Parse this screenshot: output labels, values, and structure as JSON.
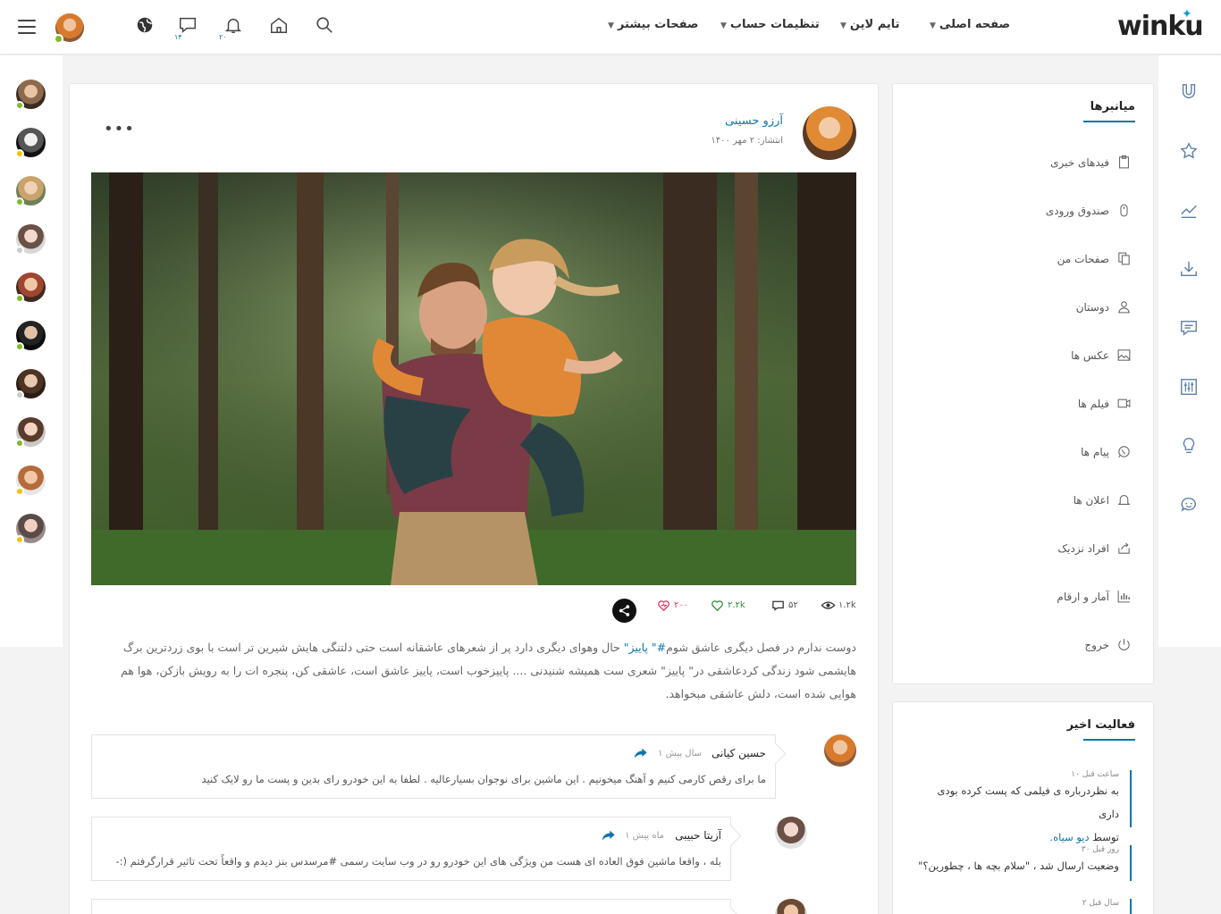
{
  "app": {
    "logo": "winku",
    "accent_color": "#0e75a8",
    "online_color": "#7fbb2a",
    "away_color": "#f4c20d",
    "offline_color": "#cccccc"
  },
  "topbar": {
    "menu": [
      "صفحه اصلی",
      "تایم لاین",
      "تنظیمات حساب",
      "صفحات بیشتر"
    ],
    "messages_badge": "۱۴",
    "notifications_badge": "۲۰"
  },
  "sidebar": {
    "title": "میانبرها",
    "items": [
      "فیدهای خبری",
      "صندوق ورودی",
      "صفحات من",
      "دوستان",
      "عکس ها",
      "فیلم ها",
      "پیام ها",
      "اعلان ها",
      "افراد نزدیک",
      "آمار و ارقام",
      "خروج"
    ]
  },
  "activity": {
    "title": "فعالیت اخیر",
    "items": [
      {
        "time": "۱۰ ساعت قبل",
        "text": "به نظردرباره ی فیلمی که پست کرده بودی داری",
        "by_prefix": "توسط",
        "by": "دیو سیاه."
      },
      {
        "time": "۳۰ روز قبل",
        "text": "وضعیت ارسال شد ، \"سلام بچه ها ، چطورین؟\""
      },
      {
        "time": "۲ سال قبل"
      }
    ]
  },
  "post": {
    "author": "آرزو حسینی",
    "date": "انتشار: ۲ مهر ۱۴۰۰",
    "more": "•••",
    "stats": {
      "views": "۱.۲k",
      "comments": "۵۲",
      "likes": "۲.۲k",
      "loves": "۲۰۰"
    },
    "text_before": "دوست ندارم در فصل دیگری عاشق شوم",
    "hashtag": "#\" پاییز\"",
    "text_after": " حال وهوای دیگری دارد پر از شعرهای عاشقانه است حتی دلتنگی هایش شیرین تر است با بوی زردترین برگ هایشمی شود زندگی کردعاشقی در\" پاییز\" شعری ست همیشه شنیدنی .... پاییزخوب است، پاییز عاشق است، عاشقی کن، پنجره ات را به رویش بازکن، هوا هم هوایی شده است، دلش عاشقی مبخواهد."
  },
  "comments": [
    {
      "name": "حسین کیانی",
      "time": "۱ سال پیش",
      "text": "ما برای رقص کارمی کنیم و آهنگ میخونیم . این ماشین برای نوجوان بسیارعالیه . لطفا به این خودرو رای بدین و پست ما رو لایک کنید"
    },
    {
      "name": "آزیتا حبیبی",
      "time": "۱ ماه پیش",
      "text": "بله ، واقعا ماشین فوق العاده ای هست من ویژگی های این خودرو رو در وب سایت رسمی #مرسدس بنز دیدم و واقعاً تحت تاثیر قرارگرفتم (:-"
    }
  ]
}
